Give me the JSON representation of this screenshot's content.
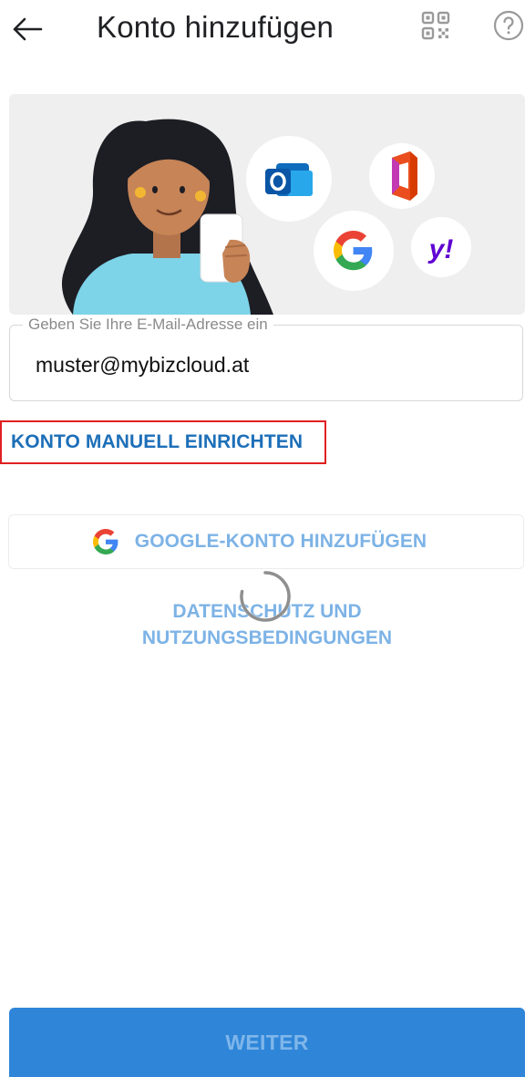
{
  "header": {
    "title": "Konto hinzufügen",
    "back_icon": "arrow-left-icon",
    "qr_icon": "qr-code-icon",
    "help_icon": "help-circle-icon"
  },
  "hero": {
    "icons": [
      "outlook-icon",
      "office-icon",
      "google-icon",
      "yahoo-icon"
    ],
    "yahoo_text": "y!"
  },
  "email": {
    "label": "Geben Sie Ihre E-Mail-Adresse ein",
    "value": "muster@mybizcloud.at"
  },
  "manual_setup": {
    "label": "KONTO MANUELL EINRICHTEN"
  },
  "google_button": {
    "label": "GOOGLE-KONTO HINZUFÜGEN"
  },
  "privacy": {
    "line1": "DATENSCHUTZ UND",
    "line2": "NUTZUNGSBEDINGUNGEN"
  },
  "continue_button": {
    "label": "WEITER"
  },
  "colors": {
    "accent": "#1d6fb8",
    "button_bg": "#2f86d9",
    "disabled_text": "#7db3e6",
    "highlight_border": "#e02020"
  }
}
